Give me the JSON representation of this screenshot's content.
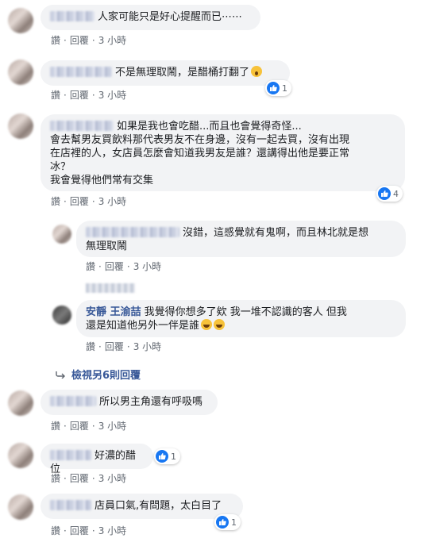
{
  "actions": {
    "like": "讚",
    "reply": "回覆",
    "sep": "·"
  },
  "colors": {
    "bubble": "#f2f3f5",
    "link": "#385898",
    "like": "#1877f2",
    "meta": "#606770"
  },
  "comments": [
    {
      "text": "人家可能只是好心提醒而已⋯⋯",
      "time": "3 小時"
    },
    {
      "text": "不是無理取鬧，是醋桶打翻了",
      "time": "3 小時",
      "reaction_count": "1",
      "reaction_icons": [
        "like-icon",
        "wow-emoji-icon"
      ]
    },
    {
      "text_lines": [
        "如果是我也會吃醋...而且也會覺得奇怪...",
        "會去幫男友買飲料那代表男友不在身邊，沒有一起去買，沒有出現",
        "在店裡的人，女店員怎麼會知道我男友是誰？還講得出他是要正常",
        "冰？",
        "我會覺得他們常有交集"
      ],
      "time": "3 小時",
      "reaction_count": "4",
      "reaction_icons": [
        "like-icon"
      ]
    },
    {
      "text_lines": [
        "沒錯，這感覺就有鬼啊，而且林北就是想",
        "無理取鬧"
      ],
      "time": "3 小時"
    },
    {
      "name": "安靜 王渝喆",
      "text_lines": [
        "我覺得你想多了欸 我一堆不認識的客人 但我",
        "還是知道他另外一伴是誰"
      ],
      "time": "3 小時",
      "emoji_icons": [
        "laugh-emoji-icon",
        "laugh-emoji-icon"
      ]
    },
    {
      "text": "所以男主角還有呼吸嗎",
      "time": "3 小時"
    },
    {
      "text": "好濃的醋位",
      "time": "3 小時",
      "reaction_count": "1",
      "reaction_icons": [
        "like-icon"
      ]
    },
    {
      "text": "店員口氣,有問題，太白目了",
      "time": "3 小時",
      "reaction_count": "1",
      "reaction_icons": [
        "like-icon"
      ]
    }
  ],
  "view_more": "檢視另6則回覆"
}
